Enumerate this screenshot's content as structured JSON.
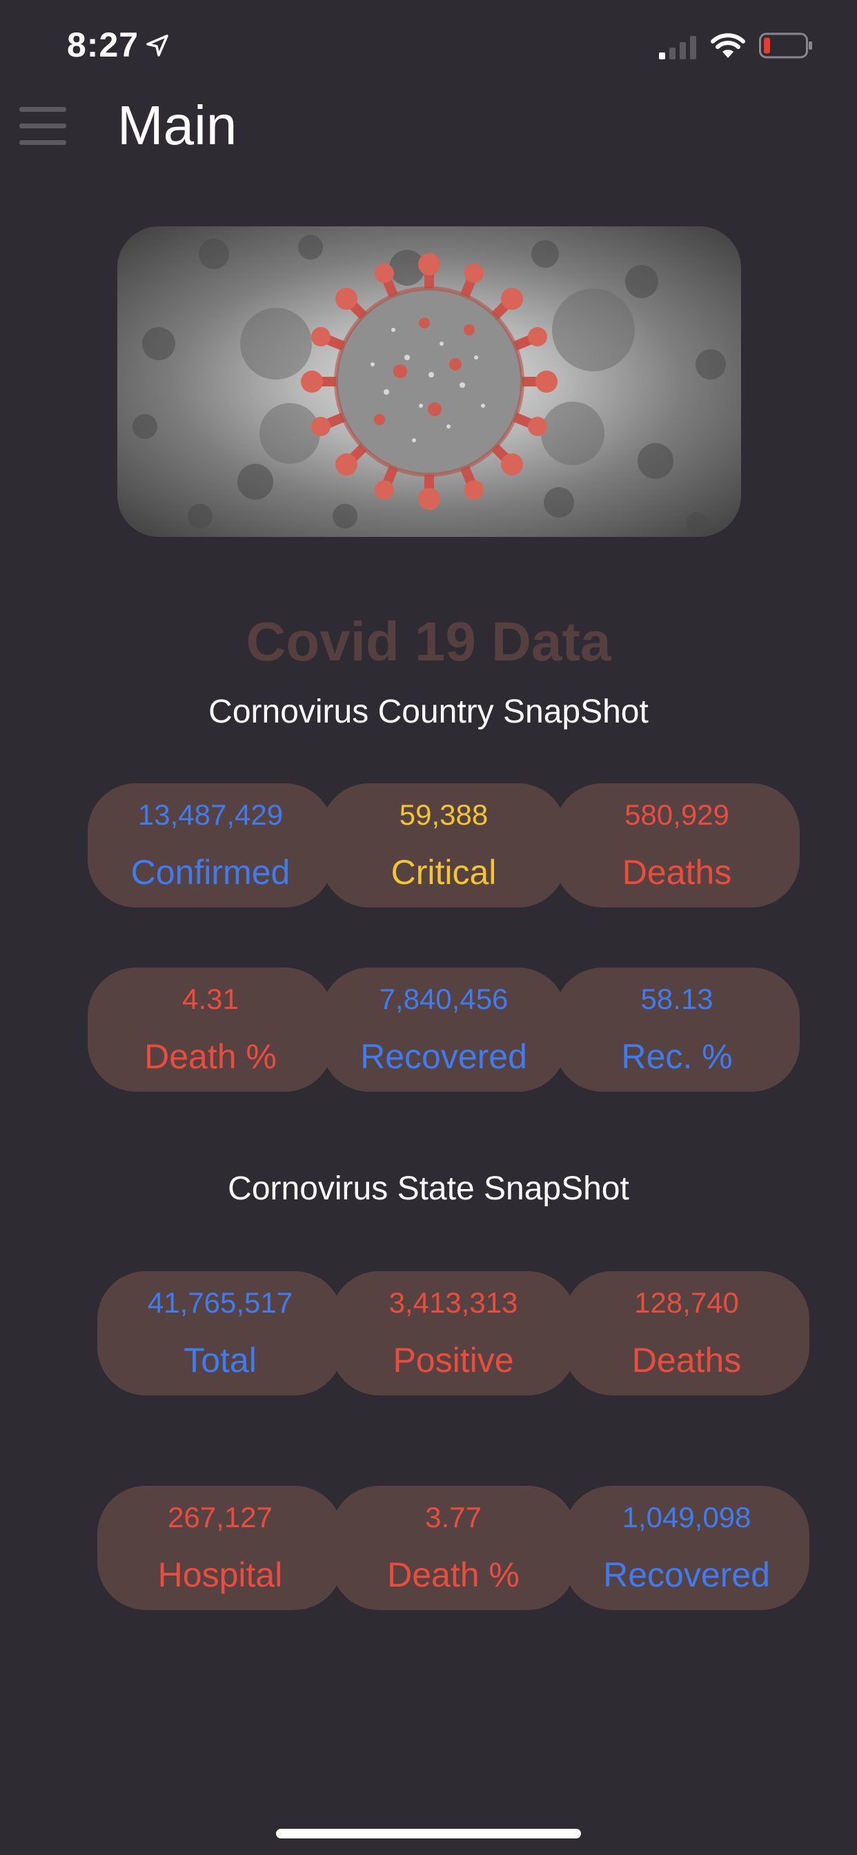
{
  "status_bar": {
    "time": "8:27"
  },
  "nav": {
    "title": "Main",
    "menu_icon": "hamburger-menu-icon"
  },
  "hero": {
    "image": "coronavirus-illustration"
  },
  "page": {
    "data_title": "Covid 19 Data"
  },
  "country": {
    "title": "Cornovirus Country SnapShot",
    "confirmed": {
      "value": "13,487,429",
      "label": "Confirmed"
    },
    "critical": {
      "value": "59,388",
      "label": "Critical"
    },
    "deaths": {
      "value": "580,929",
      "label": "Deaths"
    },
    "death_pct": {
      "value": "4.31",
      "label": "Death %"
    },
    "recovered": {
      "value": "7,840,456",
      "label": "Recovered"
    },
    "rec_pct": {
      "value": "58.13",
      "label": "Rec. %"
    }
  },
  "state": {
    "title": "Cornovirus State SnapShot",
    "total": {
      "value": "41,765,517",
      "label": "Total"
    },
    "positive": {
      "value": "3,413,313",
      "label": "Positive"
    },
    "deaths": {
      "value": "128,740",
      "label": "Deaths"
    },
    "hospital": {
      "value": "267,127",
      "label": "Hospital"
    },
    "death_pct": {
      "value": "3.77",
      "label": "Death %"
    },
    "recovered": {
      "value": "1,049,098",
      "label": "Recovered"
    }
  },
  "colors": {
    "background": "#2e2b33",
    "card": "#574242",
    "blue": "#3f7cf0",
    "yellow": "#f2c532",
    "red": "#ea4d3d",
    "title_muted": "#55403f"
  }
}
